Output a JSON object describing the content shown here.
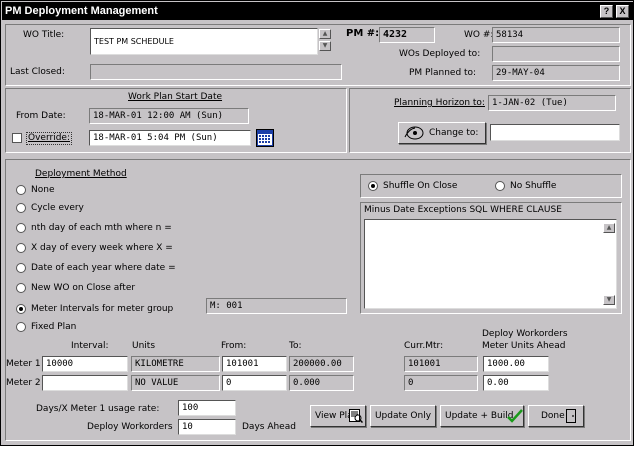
{
  "window": {
    "title": "PM Deployment Management",
    "help_label": "?",
    "close_label": "X"
  },
  "header": {
    "wo_title_label": "WO Title:",
    "wo_title_value": "TEST PM SCHEDULE",
    "last_closed_label": "Last Closed:",
    "last_closed_value": "",
    "pm_no_label": "PM #:",
    "pm_no_value": "4232",
    "wo_no_label": "WO #:",
    "wo_no_value": "58134",
    "wos_deployed_label": "WOs Deployed to:",
    "wos_deployed_value": "",
    "pm_planned_label": "PM Planned to:",
    "pm_planned_value": "29-MAY-04"
  },
  "work_plan": {
    "heading": "Work Plan Start Date",
    "from_date_label": "From Date:",
    "from_date_value": "18-MAR-01 12:00 AM (Sun)",
    "override_label": "Override:",
    "override_value": "18-MAR-01 5:04 PM (Sun)"
  },
  "planning": {
    "heading": "Planning Horizon to:",
    "horizon_value": "1-JAN-02 (Tue)",
    "change_to_label": "Change to:",
    "change_to_value": ""
  },
  "deployment": {
    "heading": "Deployment Method",
    "options": [
      "None",
      "Cycle every",
      "nth day of each mth where n  =",
      "X day of every week where X =",
      "Date of each year where date =",
      "New WO on Close after",
      "Meter Intervals for meter group",
      "Fixed Plan"
    ],
    "meter_group_value": "M: 001",
    "selected": "Meter Intervals for meter group"
  },
  "shuffle": {
    "on_close_label": "Shuffle On Close",
    "no_shuffle_label": "No Shuffle",
    "selected": "Shuffle On Close"
  },
  "exceptions": {
    "label": "Minus Date Exceptions SQL WHERE CLAUSE",
    "value": ""
  },
  "meters": {
    "col_interval": "Interval:",
    "col_units": "Units",
    "col_from": "From:",
    "col_to": "To:",
    "col_curr": "Curr.Mtr:",
    "col_deploy_line1": "Deploy Workorders",
    "col_deploy_line2": "Meter Units Ahead",
    "rows": [
      {
        "label": "Meter 1",
        "interval": "10000",
        "units": "KILOMETRE",
        "from": "101001",
        "to": "200000.00",
        "curr": "101001",
        "ahead": "1000.00"
      },
      {
        "label": "Meter 2",
        "interval": "",
        "units": "NO VALUE",
        "from": "0",
        "to": "0.000",
        "curr": "0",
        "ahead": "0.00"
      }
    ]
  },
  "footer": {
    "usage_rate_label": "Days/X Meter 1 usage rate:",
    "usage_rate_value": "100",
    "deploy_label": "Deploy Workorders",
    "deploy_value": "10",
    "days_ahead_label": "Days Ahead",
    "view_plan_label": "View Plan",
    "update_only_label": "Update Only",
    "update_build_label": "Update + Build",
    "done_label": "Done"
  },
  "colors": {
    "window_bg": "#c6c3c6",
    "titlebar_bg": "#000000",
    "titlebar_fg": "#ffffff",
    "check_green": "#1a9a1a",
    "calendar_blue": "#1c3fa8"
  },
  "icons": [
    "calendar-icon",
    "change-horizon-icon",
    "view-plan-icon",
    "checkmark-icon",
    "door-icon"
  ]
}
